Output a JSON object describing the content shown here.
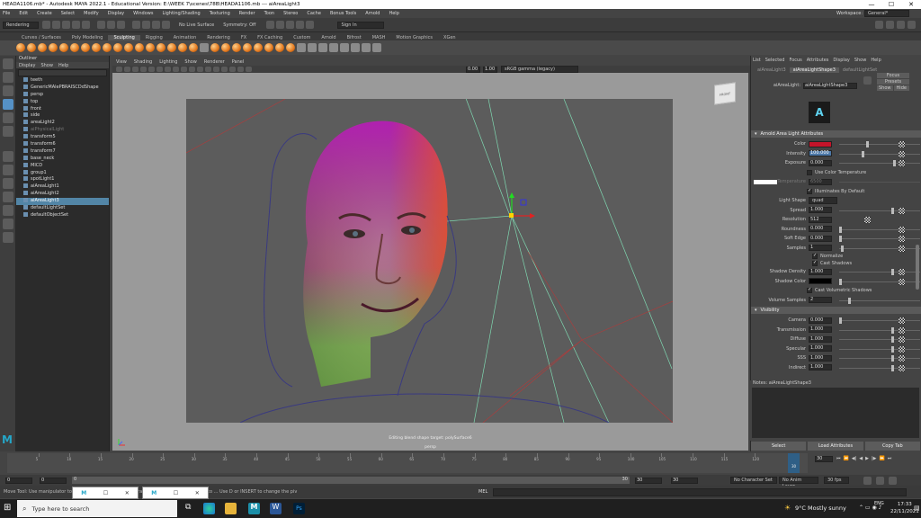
{
  "window": {
    "title": "HEADA1106.mb* - Autodesk MAYA 2022.1 - Educational Version: E:\\WEEK 7\\scenes\\78B\\HEADA1106.mb  ---  aiAreaLight3",
    "min": "—",
    "max": "☐",
    "close": "✕"
  },
  "menu": [
    "File",
    "Edit",
    "Create",
    "Select",
    "Modify",
    "Display",
    "Windows",
    "Lighting/Shading",
    "Texturing",
    "Render",
    "Toon",
    "Stereo",
    "Cache",
    "Bonus Tools",
    "Arnold",
    "Help"
  ],
  "workspace": {
    "label": "Workspace:",
    "value": "General*"
  },
  "status": {
    "mode": "Rendering",
    "live_surface": "No Live Surface",
    "symmetry": "Symmetry: Off",
    "signin": "Sign In"
  },
  "shelf_tabs": [
    "Curves / Surfaces",
    "Poly Modeling",
    "Sculpting",
    "Rigging",
    "Animation",
    "Rendering",
    "FX",
    "FX Caching",
    "Custom",
    "Arnold",
    "Bifrost",
    "MASH",
    "Motion Graphics",
    "XGen"
  ],
  "shelf_active": "Sculpting",
  "outliner": {
    "title": "Outliner",
    "menu": [
      "Display",
      "Show",
      "Help"
    ],
    "items": [
      {
        "label": "teeth",
        "state": "normal"
      },
      {
        "label": "GenericMAlePBRAISCDdShape",
        "state": "normal"
      },
      {
        "label": "persp",
        "state": "normal"
      },
      {
        "label": "top",
        "state": "normal"
      },
      {
        "label": "front",
        "state": "normal"
      },
      {
        "label": "side",
        "state": "normal"
      },
      {
        "label": "areaLight2",
        "state": "normal"
      },
      {
        "label": "aiPhysicalLight",
        "state": "grey"
      },
      {
        "label": "transform5",
        "state": "normal"
      },
      {
        "label": "transform6",
        "state": "normal"
      },
      {
        "label": "transform7",
        "state": "normal"
      },
      {
        "label": "base_neck",
        "state": "normal"
      },
      {
        "label": "MICD",
        "state": "normal"
      },
      {
        "label": "group1",
        "state": "normal"
      },
      {
        "label": "spotLight1",
        "state": "normal"
      },
      {
        "label": "aiAreaLight1",
        "state": "normal"
      },
      {
        "label": "aiAreaLight2",
        "state": "normal"
      },
      {
        "label": "aiAreaLight3",
        "state": "selected"
      },
      {
        "label": "defaultLightSet",
        "state": "normal"
      },
      {
        "label": "defaultObjectSet",
        "state": "normal"
      }
    ]
  },
  "viewport": {
    "menu": [
      "View",
      "Shading",
      "Lighting",
      "Show",
      "Renderer",
      "Panel"
    ],
    "field1": "0.00",
    "field2": "1.00",
    "colorspace": "sRGB gamma (legacy)",
    "viewcube": "FRONT",
    "hud_line1": "Editing blend shape target: polySurface6",
    "hud_line2": "persp"
  },
  "ae": {
    "menu": [
      "List",
      "Selected",
      "Focus",
      "Attributes",
      "Display",
      "Show",
      "Help"
    ],
    "tabs": [
      "aiAreaLight3",
      "aiAreaLightShape3",
      "defaultLightSet"
    ],
    "active_tab": "aiAreaLightShape3",
    "node_label": "aiAreaLight:",
    "node_value": "aiAreaLightShape3",
    "focus": "Focus",
    "presets": "Presets",
    "show": "Show",
    "hide": "Hide",
    "section1": "Arnold Area Light Attributes",
    "color_label": "Color",
    "color_value": "#c4142a",
    "intensity_label": "Intensity",
    "intensity": "100.000",
    "exposure_label": "Exposure",
    "exposure": "0.000",
    "use_color_temp": "Use Color Temperature",
    "temperature_label": "Temperature",
    "temperature": "6500",
    "illuminates": "Illuminates By Default",
    "light_shape_label": "Light Shape",
    "light_shape": "quad",
    "spread_label": "Spread",
    "spread": "1.000",
    "resolution_label": "Resolution",
    "resolution": "512",
    "roundness_label": "Roundness",
    "roundness": "0.000",
    "soft_edge_label": "Soft Edge",
    "soft_edge": "0.000",
    "samples_label": "Samples",
    "samples": "1",
    "normalize": "Normalize",
    "cast_shadows": "Cast Shadows",
    "shadow_density_label": "Shadow Density",
    "shadow_density": "1.000",
    "shadow_color_label": "Shadow Color",
    "cast_vol_shadows": "Cast Volumetric Shadows",
    "volume_samples_label": "Volume Samples",
    "volume_samples": "2",
    "section2": "Visibility",
    "vis": [
      {
        "label": "Camera",
        "value": "0.000"
      },
      {
        "label": "Transmission",
        "value": "1.000"
      },
      {
        "label": "Diffuse",
        "value": "1.000"
      },
      {
        "label": "Specular",
        "value": "1.000"
      },
      {
        "label": "SSS",
        "value": "1.000"
      },
      {
        "label": "Indirect",
        "value": "1.000"
      }
    ],
    "notes_label": "Notes: aiAreaLightShape3",
    "buttons": [
      "Select",
      "Load Attributes",
      "Copy Tab"
    ]
  },
  "timeline": {
    "ticks": [
      "5",
      "10",
      "15",
      "20",
      "25",
      "30",
      "35",
      "40",
      "45",
      "50",
      "55",
      "60",
      "65",
      "70",
      "75",
      "80",
      "85",
      "90",
      "95",
      "100",
      "105",
      "110",
      "115",
      "120"
    ],
    "current": "30",
    "frame_field": "30"
  },
  "range": {
    "start": "0",
    "start2": "0",
    "end1": "30",
    "end2": "30",
    "end3": "30",
    "character_set": "No Character Set",
    "anim_layer": "No Anim Layer",
    "fps": "30 fps"
  },
  "cmdline": {
    "mel": "MEL",
    "help": "Move Tool: Use manipulator to move object(s). Ctrl+LMB+drag on an axis or plane handle to ... Use D or INSERT to change the piv"
  },
  "taskbar": {
    "search": "Type here to search",
    "weather": "9°C  Mostly sunny",
    "time": "17:33",
    "date": "22/11/2021",
    "lang": "ENG"
  }
}
